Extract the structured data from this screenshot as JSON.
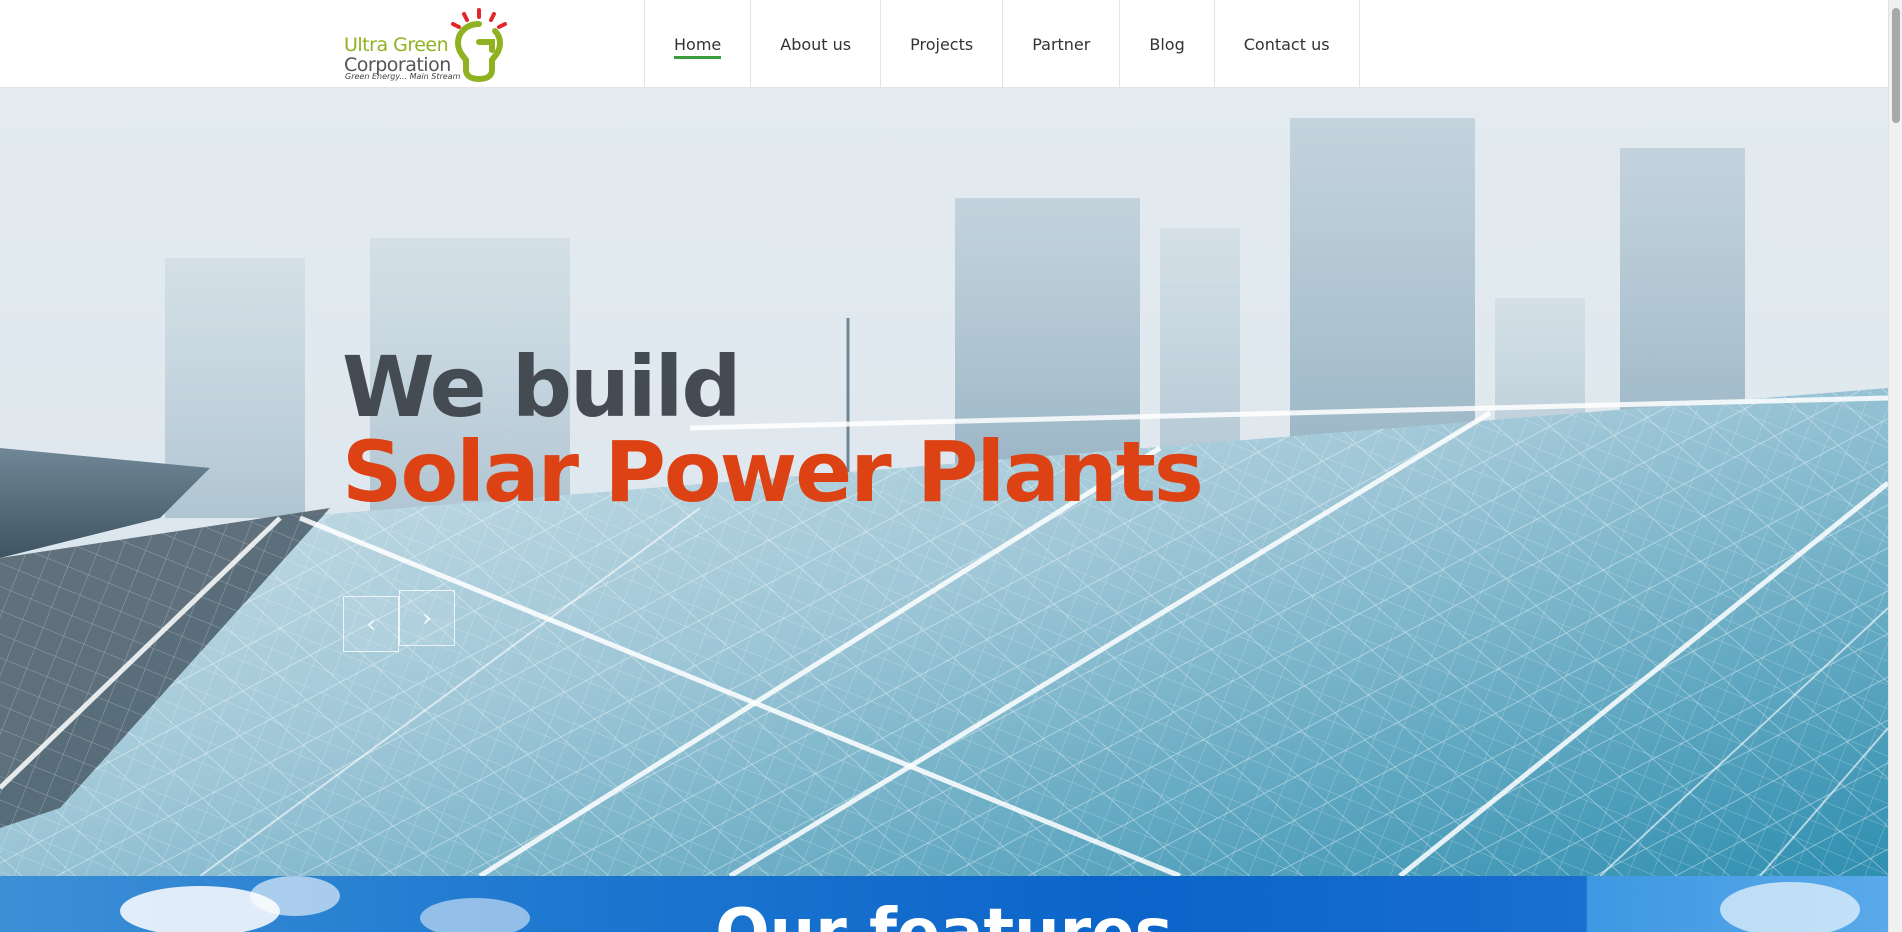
{
  "colors": {
    "brand_green": "#8fb320",
    "accent_orange": "#dd4215",
    "heading_gray": "#454b52",
    "nav_underline": "#3a9e3a"
  },
  "logo": {
    "line1": "Ultra Green",
    "line2": "Corporation",
    "tagline": "Green Energy... Main Stream",
    "icon": "lightbulb-g-icon"
  },
  "nav": {
    "items": [
      {
        "label": "Home",
        "active": true
      },
      {
        "label": "About us",
        "active": false
      },
      {
        "label": "Projects",
        "active": false
      },
      {
        "label": "Partner",
        "active": false
      },
      {
        "label": "Blog",
        "active": false
      },
      {
        "label": "Contact us",
        "active": false
      }
    ]
  },
  "hero": {
    "line1": "We build",
    "line2": "Solar Power Plants",
    "prev_icon": "chevron-left-icon",
    "next_icon": "chevron-right-icon",
    "prev_glyph": "‹",
    "next_glyph": "›"
  },
  "features": {
    "title": "Our features"
  }
}
